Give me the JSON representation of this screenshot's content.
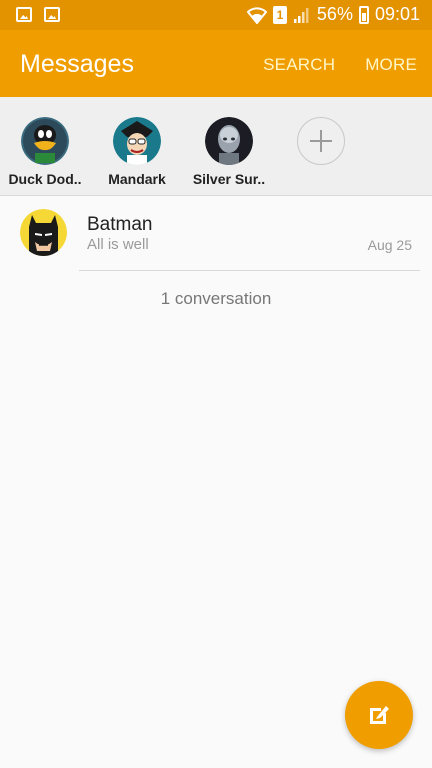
{
  "status_bar": {
    "battery_percent": "56%",
    "time": "09:01",
    "sim_label": "1",
    "icons": [
      "gallery-icon",
      "screenshot-icon",
      "wifi-icon",
      "sim-icon",
      "signal-icon",
      "battery-charging-icon"
    ]
  },
  "app_bar": {
    "title": "Messages",
    "actions": [
      "SEARCH",
      "MORE"
    ]
  },
  "contacts": [
    {
      "name": "Duck Dod..",
      "avatar": "duck-dodgers-avatar"
    },
    {
      "name": "Mandark",
      "avatar": "mandark-avatar"
    },
    {
      "name": "Silver Sur..",
      "avatar": "silver-surfer-avatar"
    }
  ],
  "add_contact_icon": "plus-icon",
  "conversations": [
    {
      "name": "Batman",
      "preview": "All is well",
      "date": "Aug 25",
      "avatar": "batman-avatar"
    }
  ],
  "conversation_count": "1 conversation",
  "fab": {
    "icon": "compose-icon"
  },
  "colors": {
    "status_bar": "#e39200",
    "app_bar": "#f09d00",
    "action_text": "#fff7c8",
    "contacts_bg": "#efefef",
    "background": "#fafafa"
  }
}
